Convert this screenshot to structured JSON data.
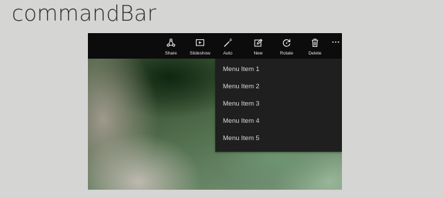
{
  "page": {
    "title": "commandBar"
  },
  "command_bar": {
    "buttons": [
      {
        "label": "Share",
        "icon": "share-icon"
      },
      {
        "label": "Slideshow",
        "icon": "slideshow-icon"
      },
      {
        "label": "Auto",
        "icon": "magic-wand-icon"
      },
      {
        "label": "New",
        "icon": "new-icon"
      },
      {
        "label": "Rotate",
        "icon": "rotate-icon"
      },
      {
        "label": "Delete",
        "icon": "trash-icon"
      }
    ],
    "more": {
      "icon": "more-ellipsis-icon"
    }
  },
  "menu": {
    "items": [
      {
        "label": "Menu Item 1"
      },
      {
        "label": "Menu Item 2"
      },
      {
        "label": "Menu Item 3"
      },
      {
        "label": "Menu Item 4"
      },
      {
        "label": "Menu Item 5"
      }
    ]
  }
}
